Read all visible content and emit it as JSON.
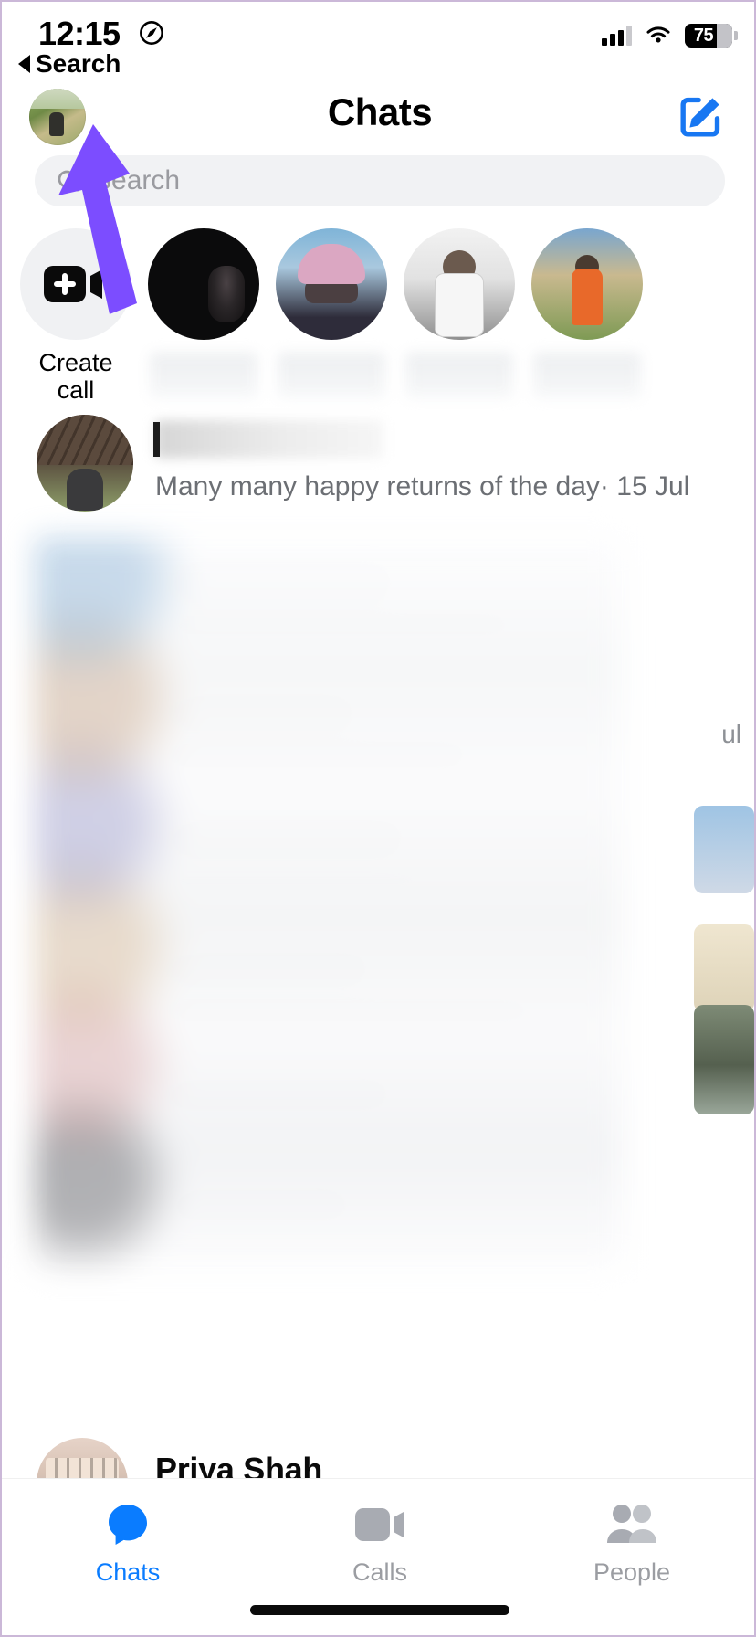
{
  "status_bar": {
    "time": "12:15",
    "location_icon": "location-arrow-icon",
    "signal_icon": "cellular-signal-icon",
    "wifi_icon": "wifi-icon",
    "battery_level": "75",
    "battery_icon": "battery-icon"
  },
  "back_nav": {
    "label": "Search",
    "icon": "back-caret-icon"
  },
  "header": {
    "title": "Chats",
    "avatar_name": "profile-avatar",
    "compose_label": "compose-new-message",
    "compose_icon": "compose-pencil-square-icon"
  },
  "search": {
    "placeholder": "Search",
    "icon": "magnifier-icon"
  },
  "stories": {
    "create_call": {
      "line1": "Create",
      "line2": "call",
      "icon": "video-camera-plus-icon"
    },
    "items": [
      {
        "name": "",
        "redacted": true,
        "photo": "dark-couple-photo"
      },
      {
        "name": "",
        "redacted": true,
        "photo": "pink-hat-woman-photo"
      },
      {
        "name": "",
        "redacted": true,
        "photo": "white-shirt-man-photo"
      },
      {
        "name": "",
        "redacted": true,
        "photo": "orange-vest-man-photo"
      }
    ]
  },
  "chats": [
    {
      "name": "",
      "name_redacted": true,
      "preview": "Many many happy returns of the day· 15 Jul",
      "avatar": "birthday-contact-avatar"
    },
    {
      "name": "Priya Shah",
      "name_redacted": false,
      "preview": "",
      "avatar": "priya-shah-avatar"
    }
  ],
  "redaction": {
    "note": "blurred-privacy-overlay"
  },
  "annotation": {
    "arrow_color": "#7c4dff",
    "points_at": "profile-avatar"
  },
  "tabs": [
    {
      "label": "Chats",
      "icon": "chat-bubble-icon",
      "active": true,
      "color": "#0a7cff"
    },
    {
      "label": "Calls",
      "icon": "video-camera-icon",
      "active": false,
      "color": "#9b9da2"
    },
    {
      "label": "People",
      "icon": "two-people-icon",
      "active": false,
      "color": "#9b9da2"
    }
  ]
}
